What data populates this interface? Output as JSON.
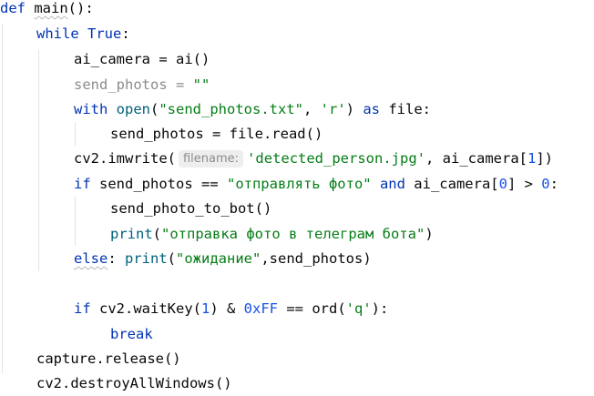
{
  "editor": {
    "lines": {
      "l1": {
        "def": "def",
        "main": "main",
        "tail": "():"
      },
      "l2": {
        "while": "while",
        "true": "True",
        "colon": ":"
      },
      "l3": {
        "a": "ai_camera = ai()"
      },
      "l4": {
        "a": "send_photos = ",
        "str": "\"\""
      },
      "l5": {
        "with": "with",
        "open": "open",
        "p1": "(",
        "s1": "\"send_photos.txt\"",
        "comma": ", ",
        "s2": "'r'",
        "p2": ") ",
        "as": "as",
        "rest": " file:"
      },
      "l6": {
        "a": "send_photos = file.read()"
      },
      "l7": {
        "a": "cv2.imwrite(",
        "hint": "filename:",
        "s": "'detected_person.jpg'",
        "b": ", ai_camera[",
        "n": "1",
        "c": "])"
      },
      "l8": {
        "if": "if",
        "a": " send_photos == ",
        "s": "\"отправлять фото\"",
        "sp1": " ",
        "and": "and",
        "b": " ai_camera[",
        "n0": "0",
        "c": "] > ",
        "n1": "0",
        "d": ":"
      },
      "l9": {
        "a": "send_photo_to_bot()"
      },
      "l10": {
        "print": "print",
        "p1": "(",
        "s": "\"отправка фото в телеграм бота\"",
        "p2": ")"
      },
      "l11": {
        "else": "else",
        "colon": ": ",
        "print": "print",
        "p1": "(",
        "s": "\"ожидание\"",
        "rest": ",send_photos)"
      },
      "l12": {
        "if": "if",
        "a": " cv2.waitKey(",
        "n1": "1",
        "b": ") & ",
        "hex": "0xFF",
        "c": " == ord(",
        "s": "'q'",
        "d": "):"
      },
      "l13": {
        "break": "break"
      },
      "l14": {
        "a": "capture.release()"
      },
      "l15": {
        "a": "cv2.destroyAllWindows()"
      }
    }
  },
  "colors": {
    "keyword": "#0033b3",
    "string": "#067d17",
    "number": "#1750eb",
    "builtin": "#00627a",
    "unused": "#8c8c8c"
  }
}
